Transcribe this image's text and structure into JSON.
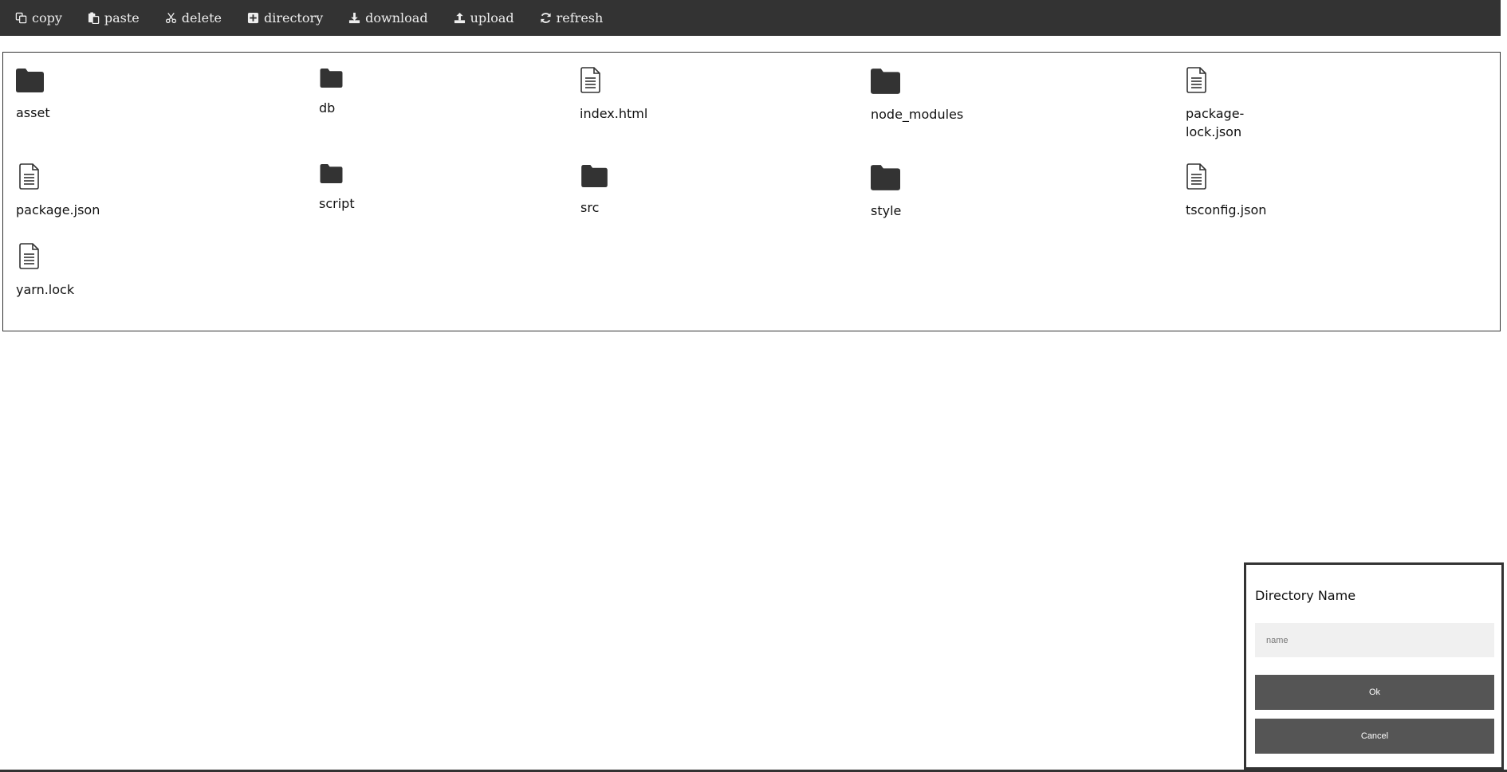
{
  "toolbar": {
    "copy": "copy",
    "paste": "paste",
    "delete": "delete",
    "directory": "directory",
    "download": "download",
    "upload": "upload",
    "refresh": "refresh"
  },
  "files": [
    {
      "name": "asset",
      "type": "folder"
    },
    {
      "name": "db",
      "type": "folder"
    },
    {
      "name": "index.html",
      "type": "file"
    },
    {
      "name": "node_modules",
      "type": "folder"
    },
    {
      "name": "package-lock.json",
      "type": "file"
    },
    {
      "name": "package.json",
      "type": "file"
    },
    {
      "name": "script",
      "type": "folder"
    },
    {
      "name": "src",
      "type": "folder"
    },
    {
      "name": "style",
      "type": "folder"
    },
    {
      "name": "tsconfig.json",
      "type": "file"
    },
    {
      "name": "yarn.lock",
      "type": "file"
    }
  ],
  "dialog": {
    "title": "Directory Name",
    "input_placeholder": "name",
    "input_value": "",
    "ok_label": "Ok",
    "cancel_label": "Cancel"
  },
  "colors": {
    "toolbar_bg": "#333333",
    "toolbar_text": "#eeeeee",
    "button_bg": "#555555",
    "input_bg": "#f0f0f0"
  }
}
